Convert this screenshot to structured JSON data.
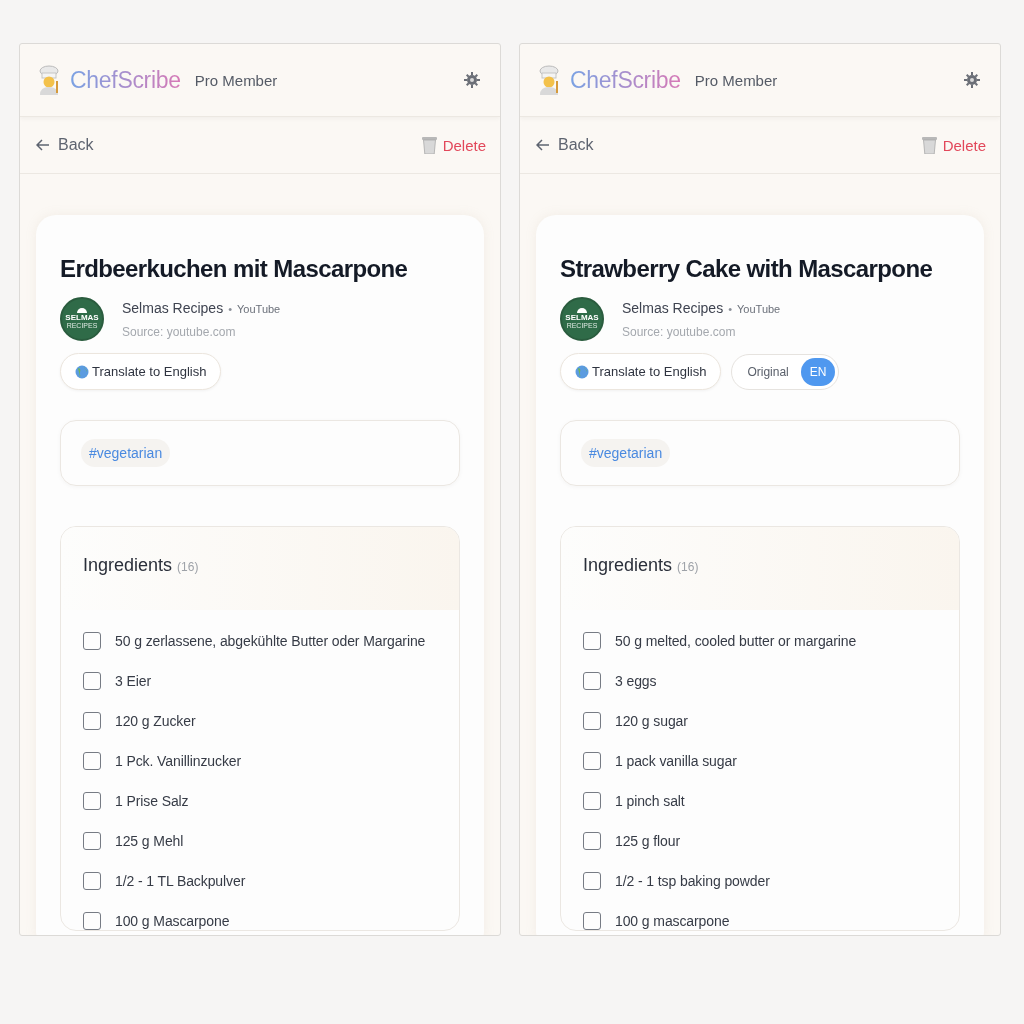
{
  "panels": [
    {
      "header": {
        "brand": "ChefScribe",
        "membership": "Pro Member"
      },
      "nav": {
        "back": "Back",
        "delete": "Delete"
      },
      "recipe": {
        "title": "Erdbeerkuchen mit Mascarpone",
        "channel_logo": [
          "SELMAS",
          "RECIPES"
        ],
        "channel": "Selmas Recipes",
        "separator": "•",
        "platform": "YouTube",
        "source": "Source: youtube.com",
        "translate_button": "Translate to English"
      },
      "tags": [
        "#vegetarian"
      ],
      "ingredients": {
        "heading": "Ingredients",
        "count": "(16)",
        "items": [
          {
            "text": "50 g zerlassene, abgekühlte Butter oder Margarine",
            "checked": false
          },
          {
            "text": "3 Eier",
            "checked": false
          },
          {
            "text": "120 g Zucker",
            "checked": false
          },
          {
            "text": "1 Pck. Vanillinzucker",
            "checked": false
          },
          {
            "text": "1 Prise Salz",
            "checked": false
          },
          {
            "text": "125 g Mehl",
            "checked": false
          },
          {
            "text": "1/2 - 1 TL Backpulver",
            "checked": false
          },
          {
            "text": "100 g Mascarpone",
            "checked": false
          }
        ]
      }
    },
    {
      "header": {
        "brand": "ChefScribe",
        "membership": "Pro Member"
      },
      "nav": {
        "back": "Back",
        "delete": "Delete"
      },
      "recipe": {
        "title": "Strawberry Cake with Mascarpone",
        "channel_logo": [
          "SELMAS",
          "RECIPES"
        ],
        "channel": "Selmas Recipes",
        "separator": "•",
        "platform": "YouTube",
        "source": "Source: youtube.com",
        "translate_button": "Translate to English",
        "language_toggle": [
          {
            "label": "Original",
            "selected": false
          },
          {
            "label": "EN",
            "selected": true
          }
        ]
      },
      "tags": [
        "#vegetarian"
      ],
      "ingredients": {
        "heading": "Ingredients",
        "count": "(16)",
        "items": [
          {
            "text": "50 g melted, cooled butter or margarine",
            "checked": false
          },
          {
            "text": "3 eggs",
            "checked": false
          },
          {
            "text": "120 g sugar",
            "checked": false
          },
          {
            "text": "1 pack vanilla sugar",
            "checked": false
          },
          {
            "text": "1 pinch salt",
            "checked": false
          },
          {
            "text": "125 g flour",
            "checked": false
          },
          {
            "text": "1/2 - 1 tsp baking powder",
            "checked": false
          },
          {
            "text": "100 g mascarpone",
            "checked": false
          }
        ]
      }
    }
  ]
}
